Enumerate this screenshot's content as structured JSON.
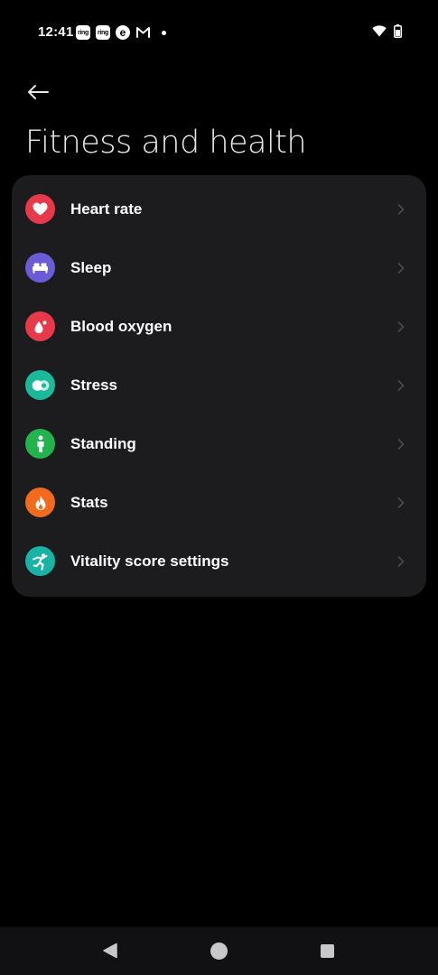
{
  "status_bar": {
    "time": "12:41",
    "notifications": [
      {
        "icon": "ring-icon",
        "text": "ring"
      },
      {
        "icon": "ring-icon",
        "text": "ring"
      },
      {
        "icon": "e-app-icon",
        "text": "e"
      },
      {
        "icon": "gmail-icon"
      }
    ],
    "system_icons": [
      "wifi-icon",
      "battery-icon"
    ]
  },
  "header": {
    "title": "Fitness and health"
  },
  "list": {
    "items": [
      {
        "label": "Heart rate",
        "icon": "heart-icon",
        "color": "#e8394a"
      },
      {
        "label": "Sleep",
        "icon": "bed-icon",
        "color": "#6b5bd6"
      },
      {
        "label": "Blood oxygen",
        "icon": "blood-drop-icon",
        "color": "#e8394a"
      },
      {
        "label": "Stress",
        "icon": "stress-icon",
        "color": "#1ab99a"
      },
      {
        "label": "Standing",
        "icon": "standing-person-icon",
        "color": "#22b34c"
      },
      {
        "label": "Stats",
        "icon": "flame-icon",
        "color": "#f26b1d"
      },
      {
        "label": "Vitality score settings",
        "icon": "vitality-icon",
        "color": "#19b3a6"
      }
    ]
  },
  "colors": {
    "background": "#000000",
    "card": "#1c1c1e",
    "chevron": "#4a4a4c"
  }
}
